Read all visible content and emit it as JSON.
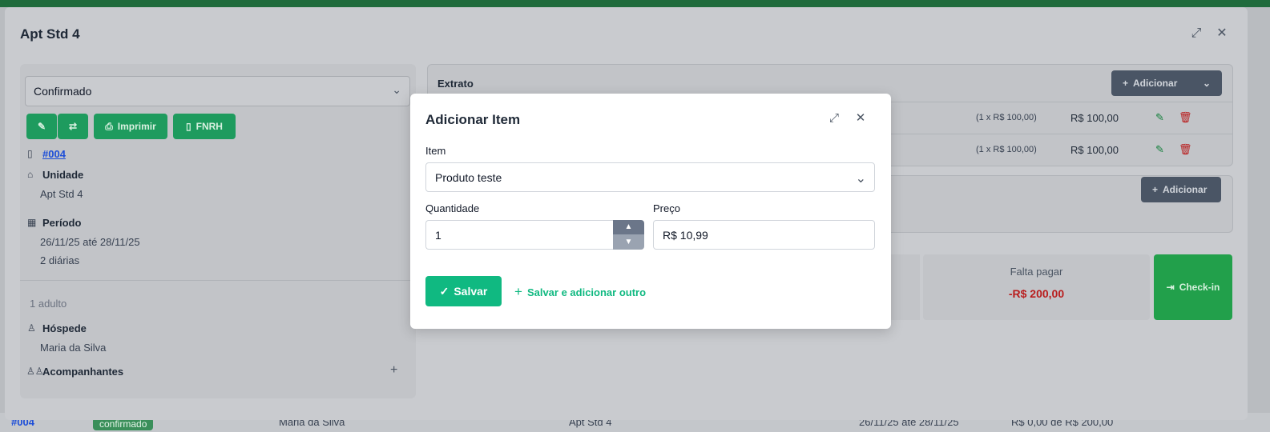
{
  "background_row": {
    "code": "#004",
    "status": "confirmado",
    "guest": "Maria da Silva",
    "unit": "Apt Std 4",
    "period": "26/11/25 até 28/11/25",
    "amount": "R$ 0,00 de R$ 200,00"
  },
  "main_modal": {
    "title": "Apt Std 4",
    "status_value": "Confirmado",
    "buttons": {
      "print": "Imprimir",
      "fnrh": "FNRH"
    },
    "reservation_code": "#004",
    "unit_label": "Unidade",
    "unit_value": "Apt Std 4",
    "period_label": "Período",
    "period_value": "26/11/25 até 28/11/25",
    "nights": "2 diárias",
    "adults": "1 adulto",
    "guest_label": "Hóspede",
    "guest_value": "Maria da Silva",
    "companions_label": "Acompanhantes"
  },
  "extrato": {
    "title": "Extrato",
    "add_label": "Adicionar",
    "lines": [
      {
        "qty": "(1 x R$ 100,00)",
        "value": "R$ 100,00"
      },
      {
        "qty": "(1 x R$ 100,00)",
        "value": "R$ 100,00"
      }
    ],
    "payments_add_label": "Adicionar"
  },
  "summary": {
    "due_label": "Falta pagar",
    "due_value": "-R$ 200,00",
    "checkin_label": "Check-in"
  },
  "dialog": {
    "title": "Adicionar Item",
    "item_label": "Item",
    "item_value": "Produto teste",
    "qty_label": "Quantidade",
    "qty_value": "1",
    "price_label": "Preço",
    "price_value": "R$ 10,99",
    "save_label": "Salvar",
    "save_more_label": "Salvar e adicionar outro"
  },
  "colors": {
    "green": "#10b981",
    "dark_button": "#4a5565",
    "danger": "#b91c1c"
  }
}
